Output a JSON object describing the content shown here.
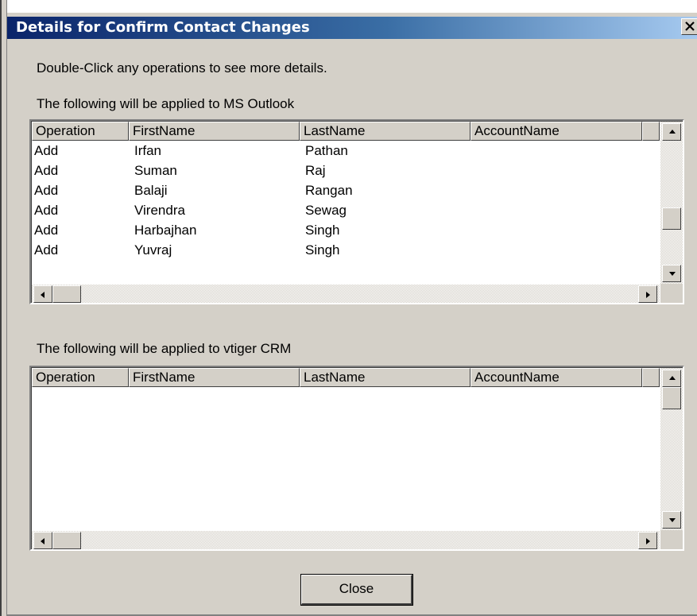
{
  "window": {
    "title": "Details for Confirm Contact Changes"
  },
  "instructions": "Double-Click any operations to see more details.",
  "outlook_section": {
    "label": "The following will be applied to MS Outlook",
    "columns": [
      "Operation",
      "FirstName",
      "LastName",
      "AccountName"
    ],
    "rows": [
      [
        "Add",
        "Irfan",
        "Pathan",
        ""
      ],
      [
        "Add",
        "Suman",
        "Raj",
        ""
      ],
      [
        "Add",
        "Balaji",
        "Rangan",
        ""
      ],
      [
        "Add",
        "Virendra",
        "Sewag",
        ""
      ],
      [
        "Add",
        "Harbajhan",
        "Singh",
        ""
      ],
      [
        "Add",
        "Yuvraj",
        "Singh",
        ""
      ]
    ]
  },
  "vtiger_section": {
    "label": "The following will be applied to vtiger CRM",
    "columns": [
      "Operation",
      "FirstName",
      "LastName",
      "AccountName"
    ],
    "rows": []
  },
  "buttons": {
    "close_label": "Close"
  },
  "icons": {
    "title_close": "close-icon",
    "scroll_up": "arrow-up-icon",
    "scroll_down": "arrow-down-icon",
    "scroll_left": "arrow-left-icon",
    "scroll_right": "arrow-right-icon"
  },
  "colors": {
    "titlebar_start": "#0a246a",
    "titlebar_end": "#a6caf0",
    "dialog_face": "#d4d0c8"
  }
}
